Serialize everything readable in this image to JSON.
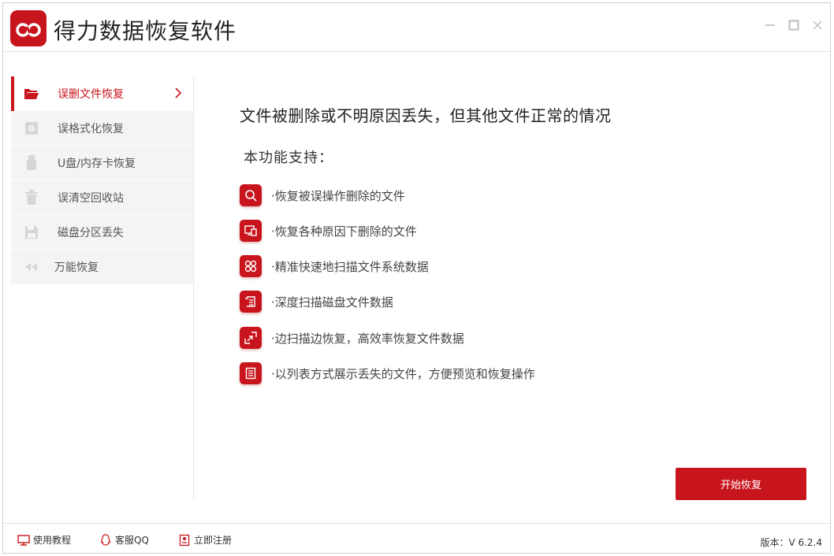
{
  "app": {
    "title": "得力数据恢复软件",
    "accent_color": "#c8151d"
  },
  "sidebar": {
    "items": [
      {
        "label": "误删文件恢复",
        "icon": "folder-open-icon",
        "active": true
      },
      {
        "label": "误格式化恢复",
        "icon": "disk-format-icon",
        "active": false
      },
      {
        "label": "U盘/内存卡恢复",
        "icon": "usb-drive-icon",
        "active": false
      },
      {
        "label": "误清空回收站",
        "icon": "trash-bin-icon",
        "active": false
      },
      {
        "label": "磁盘分区丢失",
        "icon": "save-disk-icon",
        "active": false
      },
      {
        "label": "万能恢复",
        "icon": "rewind-icon",
        "active": false
      }
    ]
  },
  "main": {
    "headline": "文件被删除或不明原因丢失，但其他文件正常的情况",
    "subhead": "本功能支持：",
    "features": [
      {
        "text": "·恢复被误操作删除的文件",
        "icon": "search-icon"
      },
      {
        "text": "·恢复各种原因下删除的文件",
        "icon": "devices-icon"
      },
      {
        "text": "·精准快速地扫描文件系统数据",
        "icon": "grid-icon"
      },
      {
        "text": "·深度扫描磁盘文件数据",
        "icon": "document-scan-icon"
      },
      {
        "text": "·边扫描边恢复，高效率恢复文件数据",
        "icon": "arrows-icon"
      },
      {
        "text": "·以列表方式展示丢失的文件，方便预览和恢复操作",
        "icon": "list-document-icon"
      }
    ],
    "start_button": "开始恢复"
  },
  "footer": {
    "tutorial": "使用教程",
    "support": "客服QQ",
    "register": "立即注册",
    "version": "版本：V 6.2.4"
  }
}
